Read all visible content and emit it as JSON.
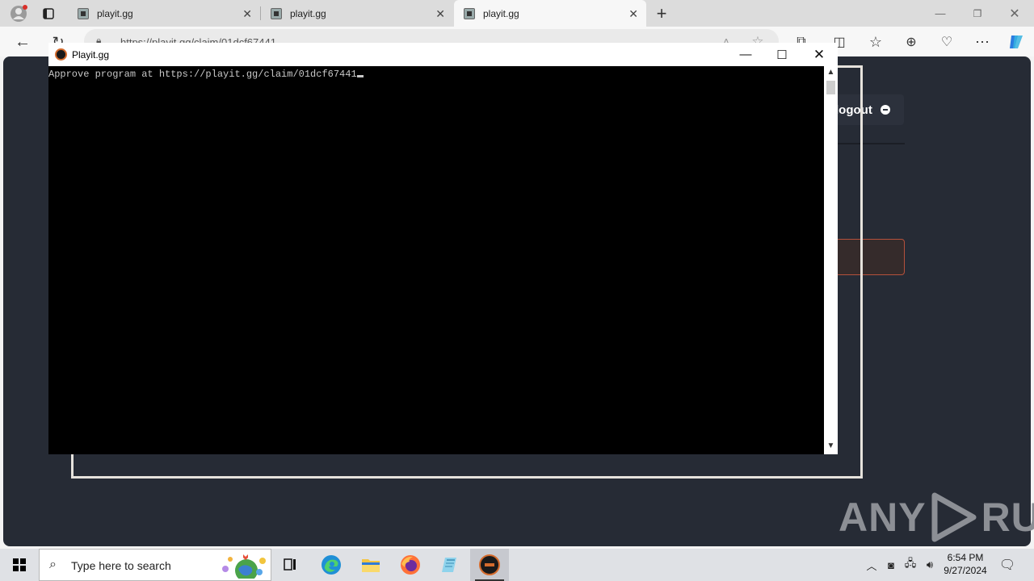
{
  "browser": {
    "tabs": [
      {
        "title": "playit.gg"
      },
      {
        "title": "playit.gg"
      },
      {
        "title": "playit.gg"
      }
    ],
    "address": "https://playit.gg/claim/01dcf67441"
  },
  "page": {
    "logout_label": "logout"
  },
  "console": {
    "title": "Playit.gg",
    "text": "Approve program at https://playit.gg/claim/01dcf67441"
  },
  "watermark": {
    "left": "ANY",
    "right": "RUN"
  },
  "taskbar": {
    "search_placeholder": "Type here to search",
    "time": "6:54 PM",
    "date": "9/27/2024"
  },
  "colors": {
    "page_bg": "#262b35",
    "alert_border": "#b5513c",
    "console_bg": "#000000",
    "taskbar_bg": "#dfe1e5"
  }
}
